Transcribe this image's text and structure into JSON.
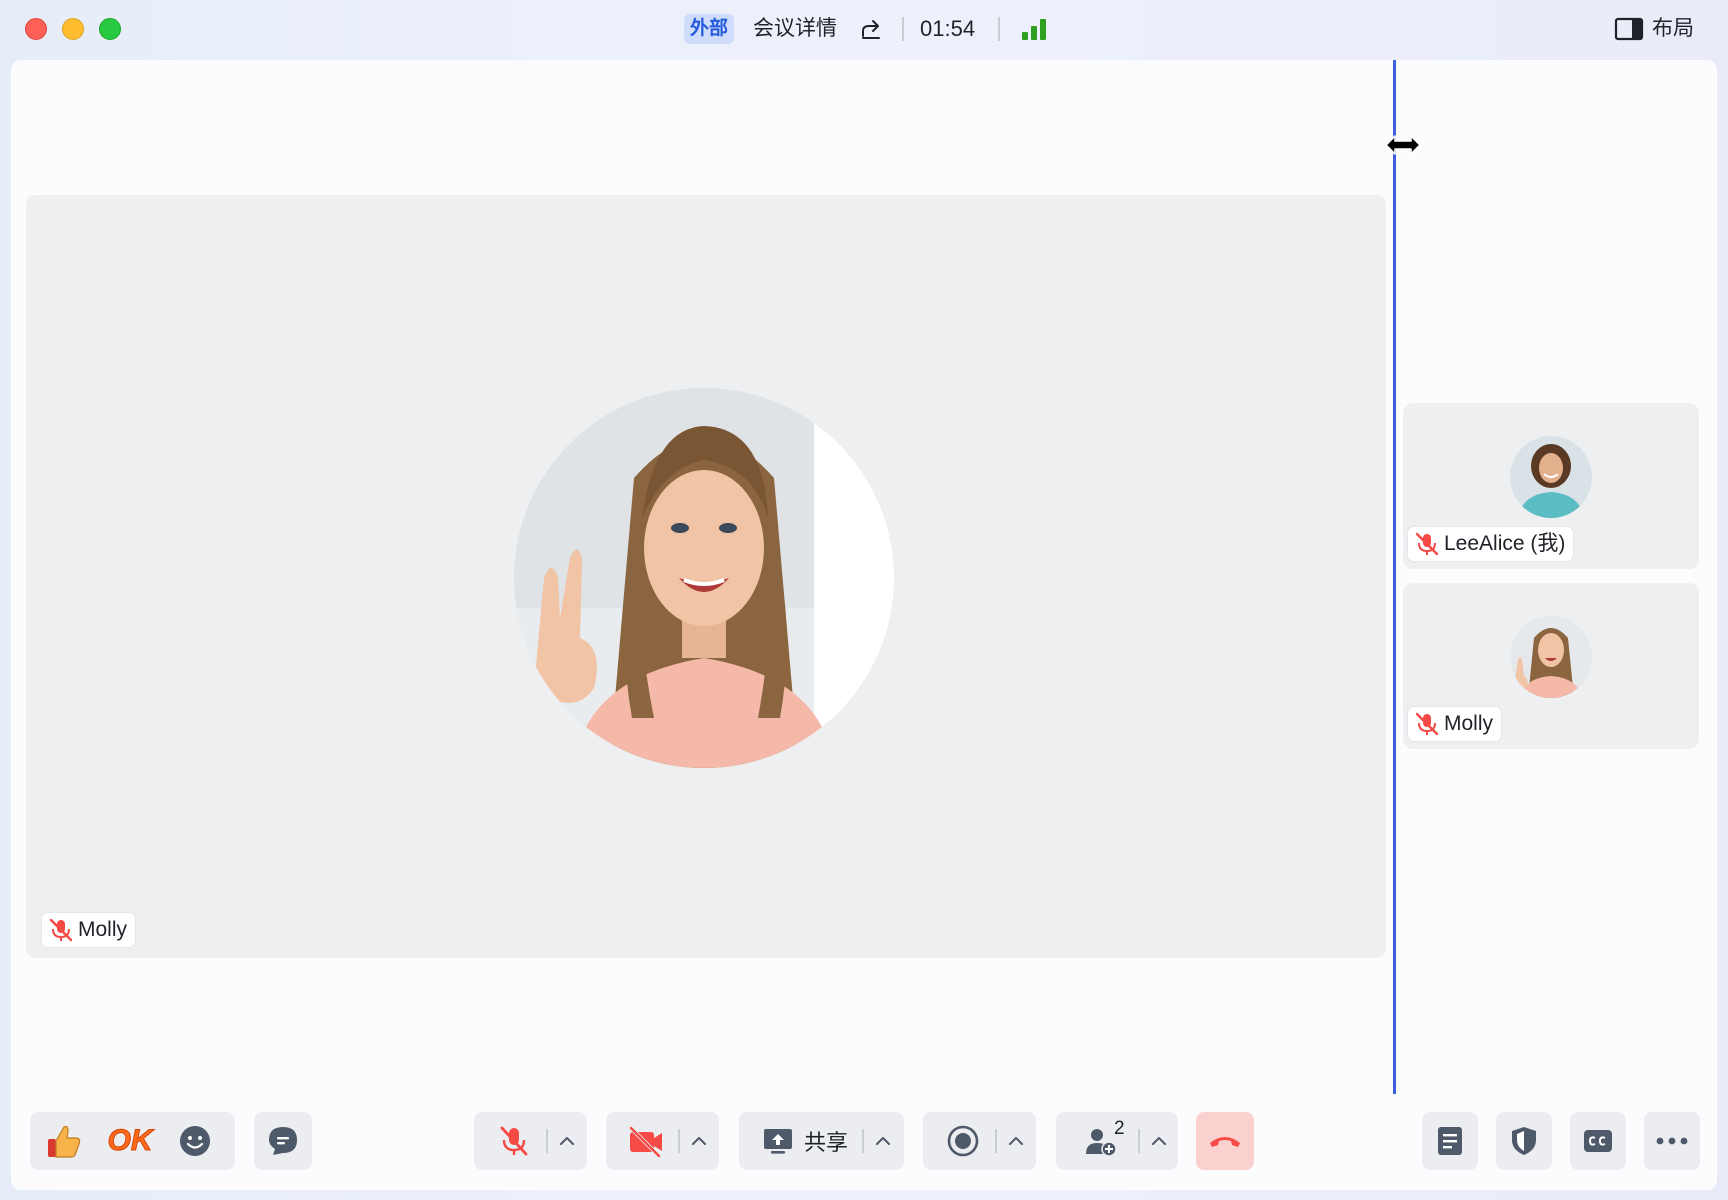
{
  "window": {
    "external_tag": "外部",
    "meeting_title": "会议详情",
    "timer": "01:54",
    "layout_label": "布局",
    "icons": [
      "share-link-icon",
      "signal-strength-icon",
      "layout-sidebar-icon"
    ]
  },
  "main_video": {
    "participant": "Molly",
    "mic_muted": true
  },
  "side_participants": [
    {
      "name": "LeeAlice (我)",
      "mic_muted": true
    },
    {
      "name": "Molly",
      "mic_muted": true
    }
  ],
  "toolbar": {
    "reactions": [
      "thumbs-up-icon",
      "ok-sticker-icon",
      "emoji-icon"
    ],
    "ok_text": "OK",
    "share_label": "共享",
    "participant_count": "2",
    "mic_muted": true,
    "camera_off": true
  },
  "colors": {
    "accent": "#245bdb",
    "divider_line": "#3b5fde",
    "muted_red": "#f54a45",
    "hangup_bg": "#fbd1cf"
  }
}
